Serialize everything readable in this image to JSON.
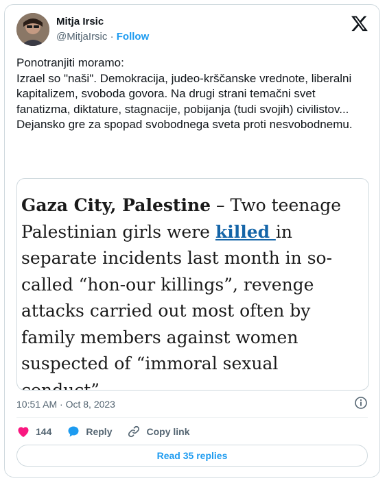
{
  "author": {
    "name": "Mitja Irsic",
    "handle": "@MitjaIrsic",
    "separator": " · ",
    "follow_label": "Follow"
  },
  "tweet": {
    "text": "Ponotranjiti moramo:\nIzrael so \"naši\". Demokracija, judeo-krščanske vrednote, liberalni kapitalizem, svoboda govora. Na drugi strani temačni svet fanatizma, diktature, stagnacije, pobijanja (tudi svojih) civilistov...\nDejansko gre za spopad svobodnega  sveta proti nesvobodnemu."
  },
  "quoted_article": {
    "dateline": "Gaza City, Palestine",
    "dash": " – Two teenage Palestinian girls were ",
    "link_text": "killed ",
    "rest": "in separate incidents last month in so-called “hon-our killings”, revenge attacks carried out most often by family members against women suspected of “immoral sexual conduct”."
  },
  "meta": {
    "timestamp": "10:51 AM · Oct 8, 2023"
  },
  "actions": {
    "like_count": "144",
    "reply_label": "Reply",
    "copy_link_label": "Copy link",
    "read_replies_label": "Read 35 replies"
  },
  "colors": {
    "accent": "#1d9bf0",
    "like": "#f91880",
    "muted": "#536471",
    "link": "#1565a8"
  },
  "icons": [
    "x-logo-icon",
    "info-icon",
    "heart-icon",
    "reply-bubble-icon",
    "link-icon"
  ]
}
